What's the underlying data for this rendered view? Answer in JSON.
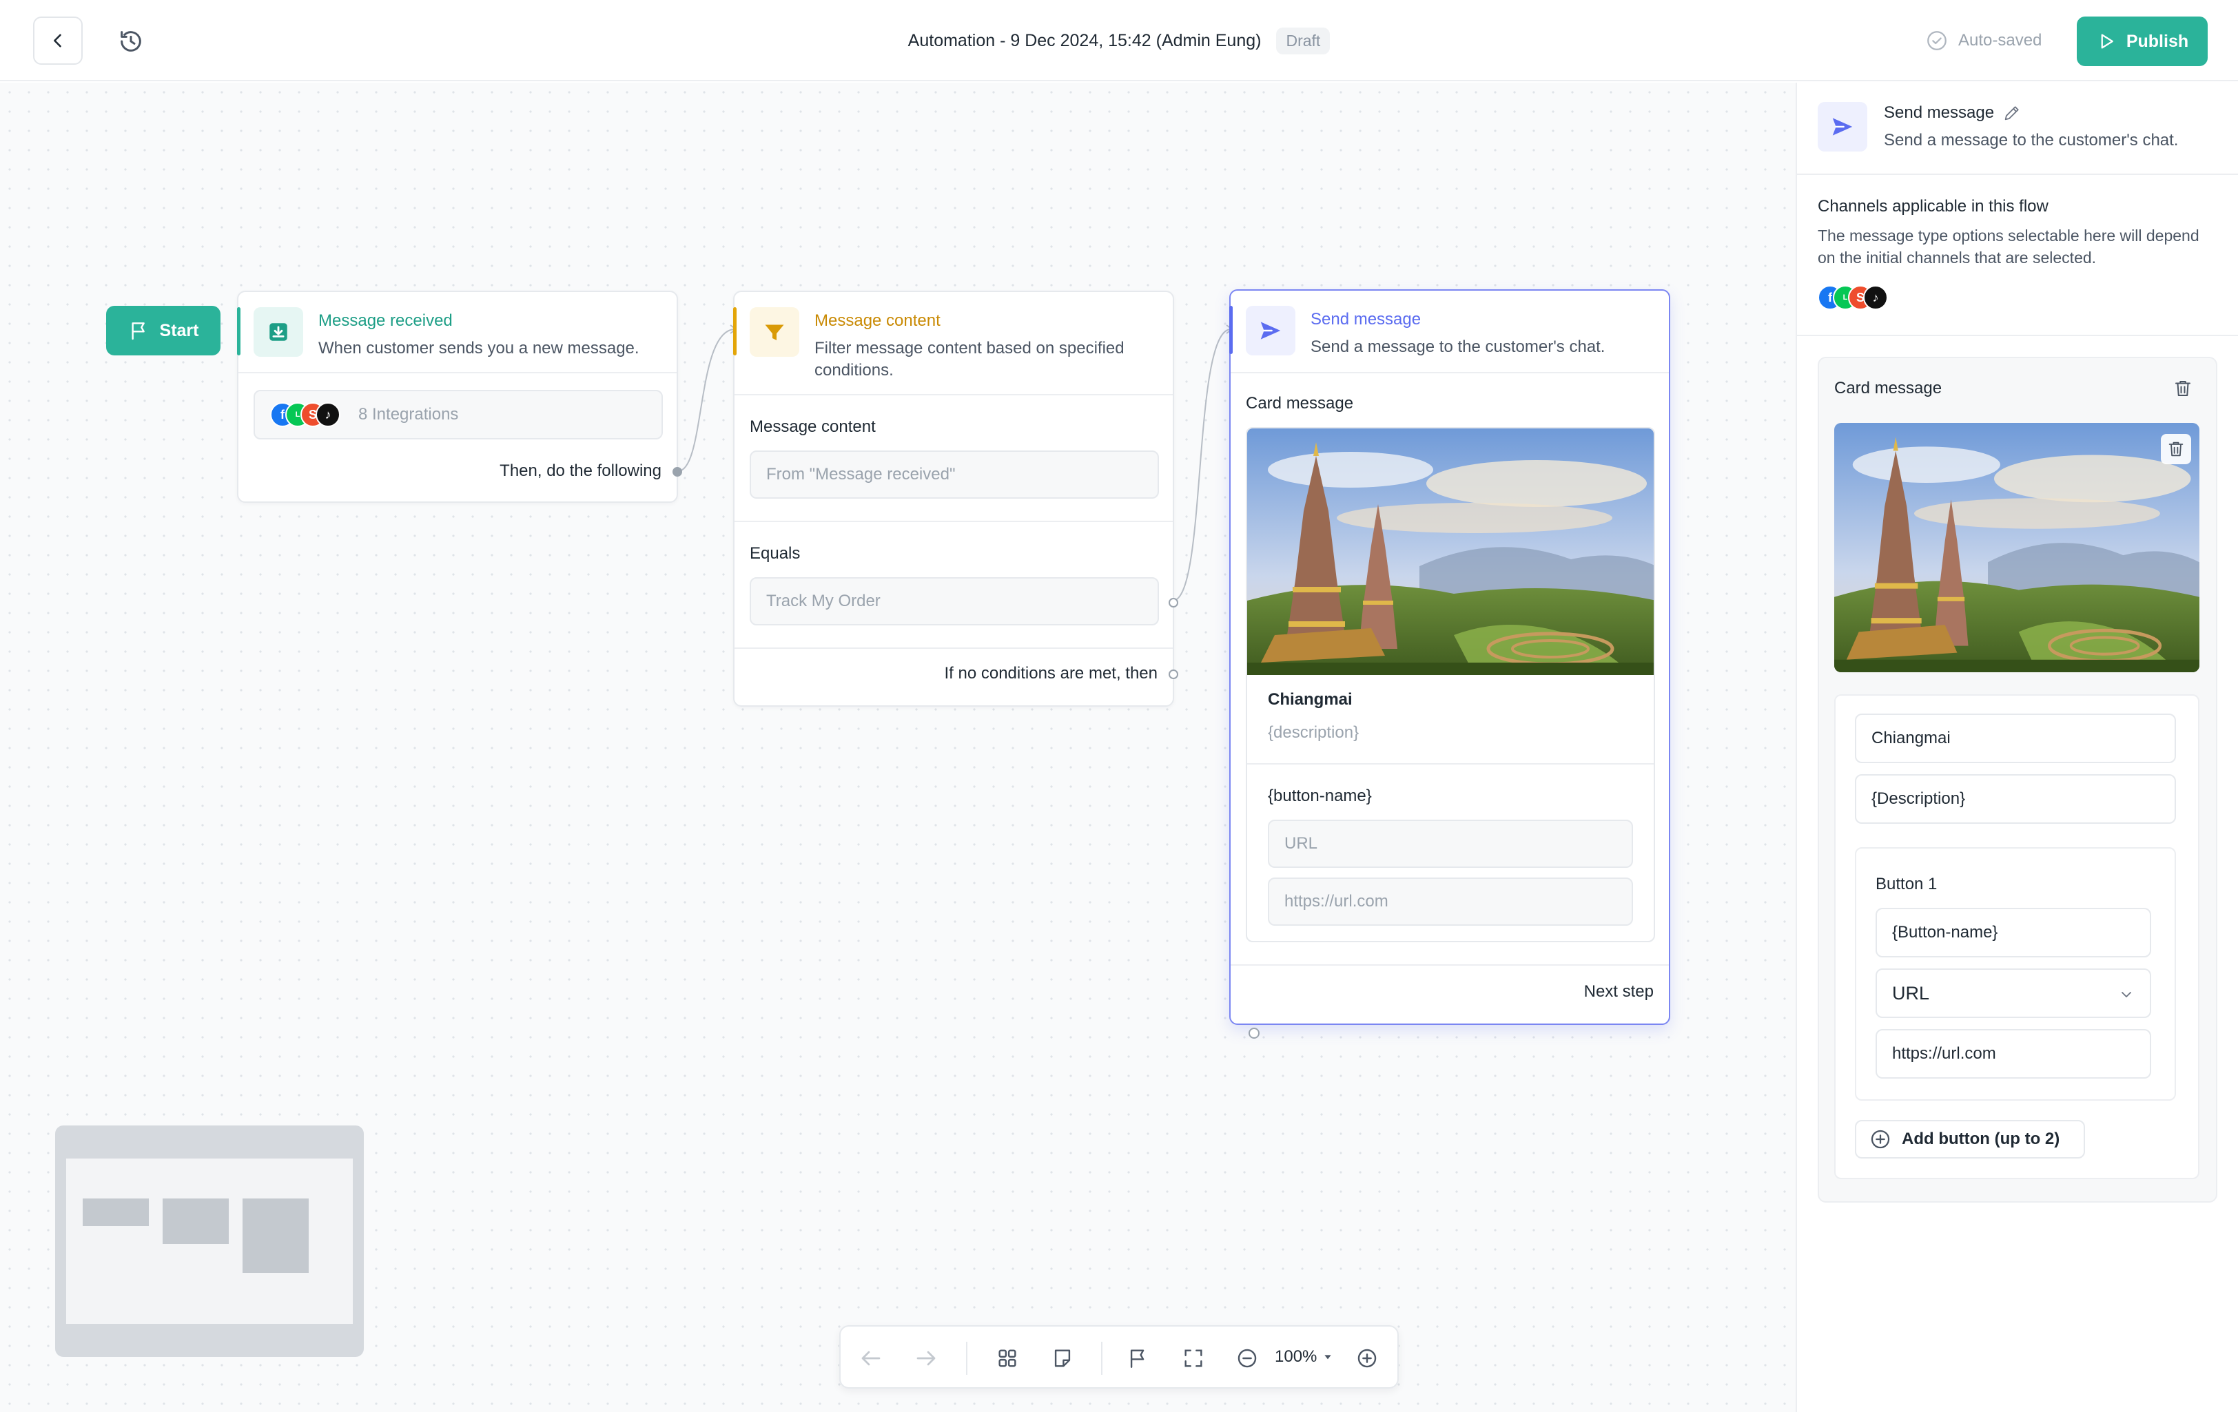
{
  "header": {
    "title": "Automation - 9 Dec 2024, 15:42 (Admin Eung)",
    "status_badge": "Draft",
    "autosave_label": "Auto-saved",
    "publish_label": "Publish"
  },
  "canvas": {
    "start_label": "Start",
    "nodes": {
      "message_received": {
        "title": "Message received",
        "description": "When customer sends you a new message.",
        "integrations_label": "8 Integrations",
        "footer_label": "Then, do the following"
      },
      "message_content": {
        "title": "Message content",
        "description": "Filter message content based on specified conditions.",
        "field1_label": "Message content",
        "field1_placeholder": "From \"Message received\"",
        "field2_label": "Equals",
        "field2_placeholder": "Track My Order",
        "footer_label": "If no conditions are met, then"
      },
      "send_message": {
        "title": "Send message",
        "description": "Send a message to the customer's chat.",
        "section_label": "Card message",
        "card_title": "Chiangmai",
        "card_description": "{description}",
        "button_name": "{button-name}",
        "button_type": "URL",
        "button_url": "https://url.com",
        "footer_label": "Next step"
      }
    }
  },
  "toolbar": {
    "zoom_level": "100%"
  },
  "panel": {
    "header_title": "Send message",
    "header_description": "Send a message to the customer's chat.",
    "channels_title": "Channels applicable in this flow",
    "channels_description": "The message type options selectable here will depend on the initial channels that are selected.",
    "card_section_title": "Card message",
    "title_value": "Chiangmai",
    "description_value": "{Description}",
    "button_group_title": "Button 1",
    "button_name_value": "{Button-name}",
    "button_type_value": "URL",
    "button_url_value": "https://url.com",
    "add_button_label": "Add button (up to 2)"
  },
  "colors": {
    "brand_green": "#2bb39a",
    "trigger_green": "#1d9e86",
    "filter_amber": "#d99a06",
    "action_blue": "#5b6cf0"
  },
  "icons": {
    "back": "chevron-left-icon",
    "history": "history-icon",
    "autosave": "check-circle-icon",
    "publish": "play-icon",
    "start": "flag-icon",
    "trigger": "inbox-download-icon",
    "filter": "funnel-icon",
    "send": "send-icon",
    "edit": "pencil-icon",
    "delete": "trash-icon",
    "add": "plus-circle-icon"
  }
}
